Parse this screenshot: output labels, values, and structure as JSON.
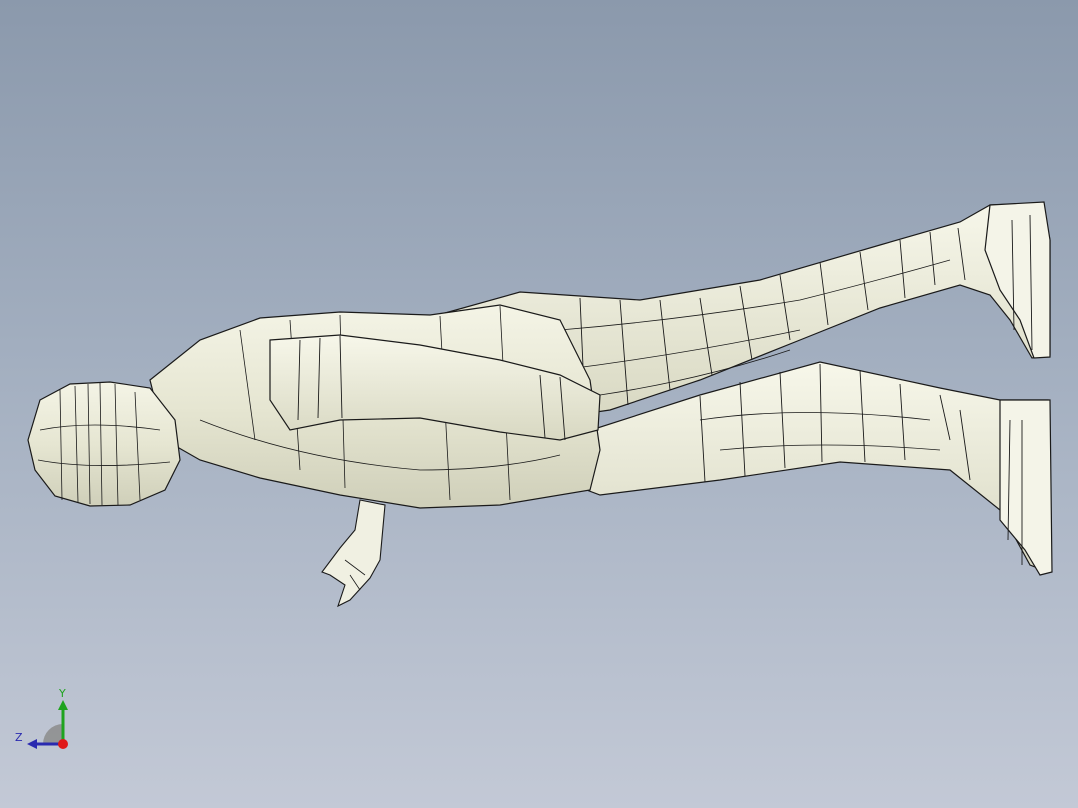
{
  "viewport": {
    "background_top": "#8b99ac",
    "background_bottom": "#c3c9d6",
    "model_fill": "#eeeede",
    "model_edge": "#1a1a1a"
  },
  "triad": {
    "y_label": "Y",
    "z_label": "Z",
    "y_color": "#1fa31f",
    "z_color": "#2a2ab0",
    "origin_color": "#e01818"
  }
}
